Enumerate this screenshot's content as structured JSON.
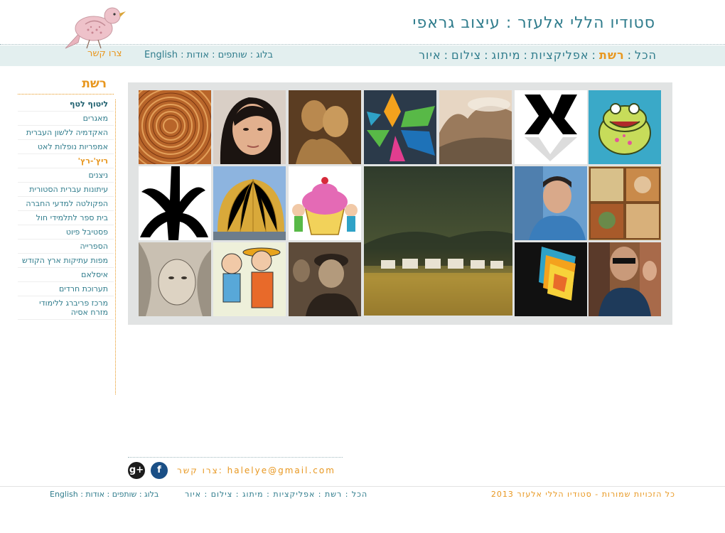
{
  "header": {
    "site_title": "סטודיו הללי אלעזר : עיצוב גראפי",
    "main_nav": [
      "הכל",
      "רשת",
      "אפליקציות",
      "מיתוג",
      "צילום",
      "איור"
    ],
    "main_nav_active": "רשת",
    "secondary_nav": "English : בלוג : שותפים : אודות",
    "contact_link": "צרו קשר"
  },
  "sidebar": {
    "title": "רשת",
    "items": [
      {
        "label": "ליטוף לטף"
      },
      {
        "label": "מאגרים"
      },
      {
        "label": "האקדמיה ללשון העברית"
      },
      {
        "label": "אמפריות נופלות לאט"
      },
      {
        "label": "ריץ'-רץ'"
      },
      {
        "label": "ניצנים"
      },
      {
        "label": "עיתונות עברית הסטורית"
      },
      {
        "label": "הפקולטה למדעי החברה"
      },
      {
        "label": "בית ספר לתלמידי חול"
      },
      {
        "label": "פסטיבל פיוט"
      },
      {
        "label": "הספרייה"
      },
      {
        "label": "מפות עתיקות ארץ הקודש"
      },
      {
        "label": "איסלאם"
      },
      {
        "label": "תערוכת חרדים"
      },
      {
        "label": "מרכז פריברג ללימודי מזרח אסיה"
      }
    ]
  },
  "gallery": {
    "tiles": [
      {
        "name": "wood-rings-thumb"
      },
      {
        "name": "woman-portrait-thumb"
      },
      {
        "name": "sculpture-thumb"
      },
      {
        "name": "geometric-star-thumb"
      },
      {
        "name": "cliff-painting-thumb"
      },
      {
        "name": "hebrew-letter-logo-thumb"
      },
      {
        "name": "frog-cartoon-thumb"
      },
      {
        "name": "black-symbol-thumb"
      },
      {
        "name": "golden-dome-thumb"
      },
      {
        "name": "cupcake-kids-thumb"
      },
      {
        "name": "yurts-landscape-thumb"
      },
      {
        "name": "man-blue-shirt-thumb"
      },
      {
        "name": "ancient-map-thumb"
      },
      {
        "name": "engraved-portrait-thumb"
      },
      {
        "name": "cartoon-family-thumb"
      },
      {
        "name": "vintage-photo-thumb"
      },
      {
        "name": "colorful-cubes-thumb"
      },
      {
        "name": "musicians-thumb"
      }
    ]
  },
  "footer": {
    "email_line": "צרו קשר: halelye@gmail.com",
    "social": {
      "gplus": "g+",
      "facebook": "f"
    },
    "nav_left": "English : בלוג : שותפים : אודות",
    "nav_mid": "הכל : רשת : אפליקציות : מיתוג : צילום : איור",
    "copyright": "כל הזכויות שמורות - סטודיו הללי אלעזר 2013"
  },
  "colors": {
    "accent_orange": "#e8971f",
    "teal_text": "#2f7c8c",
    "nav_bg": "#e3efef",
    "gallery_frame": "#e1e3e3"
  }
}
